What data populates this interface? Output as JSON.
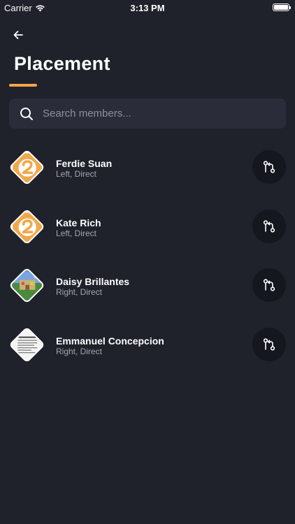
{
  "status_bar": {
    "carrier": "Carrier",
    "time": "3:13 PM"
  },
  "header": {
    "title": "Placement"
  },
  "search": {
    "placeholder": "Search members..."
  },
  "colors": {
    "background": "#1f212b",
    "accent": "#f2a64b",
    "search_bg": "#2a2d39",
    "action_bg": "#15171e"
  },
  "members": [
    {
      "name": "Ferdie Suan",
      "detail": "Left, Direct",
      "avatar": "logo-avatar"
    },
    {
      "name": "Kate Rich",
      "detail": "Left, Direct",
      "avatar": "logo-avatar"
    },
    {
      "name": "Daisy Brillantes",
      "detail": "Right, Direct",
      "avatar": "photo-avatar"
    },
    {
      "name": "Emmanuel Concepcion",
      "detail": "Right, Direct",
      "avatar": "document-avatar"
    }
  ]
}
